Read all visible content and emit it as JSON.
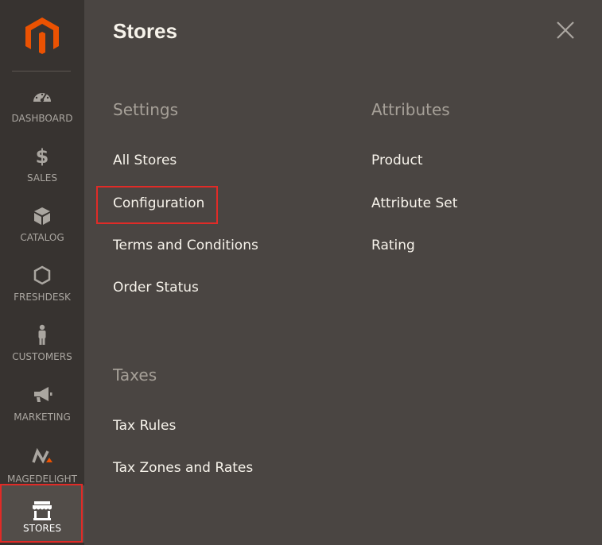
{
  "sidebar": {
    "items": [
      {
        "label": "DASHBOARD",
        "icon": "dashboard-icon"
      },
      {
        "label": "SALES",
        "icon": "dollar-icon"
      },
      {
        "label": "CATALOG",
        "icon": "box-icon"
      },
      {
        "label": "FRESHDESK",
        "icon": "hexagon-icon"
      },
      {
        "label": "CUSTOMERS",
        "icon": "person-icon"
      },
      {
        "label": "MARKETING",
        "icon": "megaphone-icon"
      },
      {
        "label": "MAGEDELIGHT",
        "icon": "magedelight-icon"
      },
      {
        "label": "STORES",
        "icon": "storefront-icon",
        "active": true
      }
    ]
  },
  "panel": {
    "title": "Stores",
    "settings": {
      "heading": "Settings",
      "links": [
        "All Stores",
        "Configuration",
        "Terms and Conditions",
        "Order Status"
      ]
    },
    "attributes": {
      "heading": "Attributes",
      "links": [
        "Product",
        "Attribute Set",
        "Rating"
      ]
    },
    "taxes": {
      "heading": "Taxes",
      "links": [
        "Tax Rules",
        "Tax Zones and Rates"
      ]
    }
  },
  "colors": {
    "sidebar_bg": "#373330",
    "panel_bg": "#4a4542",
    "accent_orange": "#eb5202",
    "highlight_red": "#e02b27"
  }
}
